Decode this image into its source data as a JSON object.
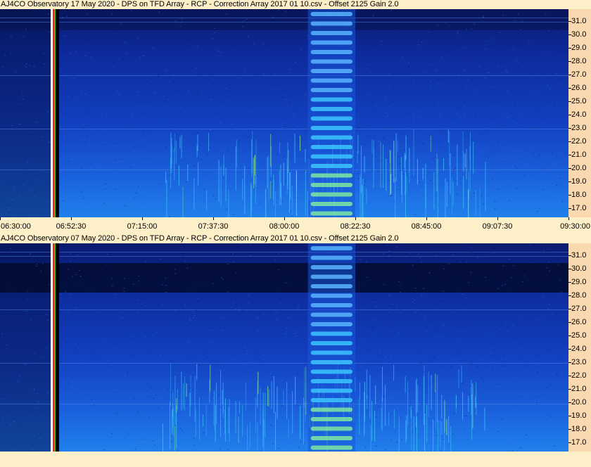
{
  "colors": {
    "background": "#fdf0c8",
    "freq_axis_bg": "#fbd9b0",
    "spectrogram_dark": "#0a1a6e",
    "spectrogram_mid": "#1240c0",
    "spectrogram_bright": "#2080ec",
    "signal_bright": "#3fc8ff",
    "signal_highlight": "#9ef07a"
  },
  "chart_data": [
    {
      "type": "heatmap",
      "title": "AJ4CO Observatory 17 May 2020  -  DPS on TFD Array  -  RCP  -  Correction Array 2017 01 10.csv  -  Offset 2125  Gain 2.0",
      "y_unit": "MHz",
      "ylim": [
        16.3,
        31.9
      ],
      "y_ticks": [
        "31.0",
        "30.0",
        "29.0",
        "28.0",
        "27.0",
        "26.0",
        "25.0",
        "24.0",
        "23.0",
        "22.0",
        "21.0",
        "20.0",
        "19.0",
        "18.0",
        "17.0"
      ],
      "x_ticks": [
        "06:30:00",
        "06:52:30",
        "07:15:00",
        "07:37:30",
        "08:00:00",
        "08:22:30",
        "08:45:00",
        "09:07:30",
        "09:30:00"
      ],
      "xlim": [
        "06:30:00",
        "09:30:00"
      ],
      "banded_burst": {
        "start": "08:07:30",
        "end": "08:22:30"
      }
    },
    {
      "type": "heatmap",
      "title": "AJ4CO Observatory 07 May 2020  -  DPS on TFD Array  -  RCP  -  Correction Array 2017 01 10.csv  -  Offset 2125  Gain 2.0",
      "y_unit": "MHz",
      "ylim": [
        16.3,
        31.9
      ],
      "y_ticks": [
        "31.0",
        "30.0",
        "29.0",
        "28.0",
        "27.0",
        "26.0",
        "25.0",
        "24.0",
        "23.0",
        "22.0",
        "21.0",
        "20.0",
        "19.0",
        "18.0",
        "17.0"
      ],
      "x_ticks": [],
      "xlim": [
        "06:30:00",
        "09:30:00"
      ],
      "banded_burst": {
        "start": "08:07:30",
        "end": "08:22:30"
      }
    }
  ]
}
